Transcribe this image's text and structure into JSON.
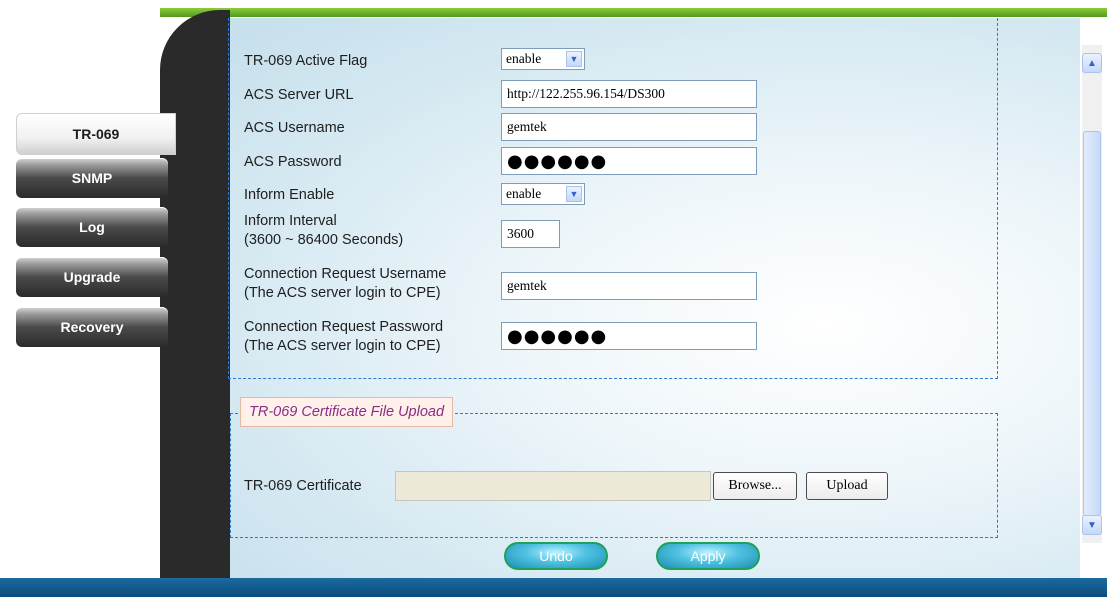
{
  "sidebar": {
    "items": [
      {
        "label": "TR-069",
        "active": true
      },
      {
        "label": "SNMP",
        "active": false
      },
      {
        "label": "Log",
        "active": false
      },
      {
        "label": "Upgrade",
        "active": false
      },
      {
        "label": "Recovery",
        "active": false
      }
    ]
  },
  "form": {
    "active_flag": {
      "label": "TR-069 Active Flag",
      "value": "enable"
    },
    "acs_url": {
      "label": "ACS Server URL",
      "value": "http://122.255.96.154/DS300"
    },
    "acs_username": {
      "label": "ACS Username",
      "value": "gemtek"
    },
    "acs_password": {
      "label": "ACS Password",
      "value": "●●●●●●"
    },
    "inform_enable": {
      "label": "Inform Enable",
      "value": "enable"
    },
    "inform_interval": {
      "label_line1": "Inform Interval",
      "label_line2": "(3600 ~ 86400 Seconds)",
      "value": "3600"
    },
    "conn_req_username": {
      "label_line1": "Connection Request Username",
      "label_line2": "(The ACS server login to CPE)",
      "value": "gemtek"
    },
    "conn_req_password": {
      "label_line1": "Connection Request Password",
      "label_line2": "(The ACS server login to CPE)",
      "value": "●●●●●●"
    }
  },
  "certificate": {
    "legend": "TR-069 Certificate File Upload",
    "label": "TR-069 Certificate",
    "file_value": "",
    "browse_label": "Browse...",
    "upload_label": "Upload"
  },
  "actions": {
    "undo_label": "Undo",
    "apply_label": "Apply"
  },
  "icons": {
    "select_arrow": "chevron-down-icon",
    "scroll_up": "chevron-up-icon",
    "scroll_down": "chevron-down-icon"
  },
  "colors": {
    "top_accent": "#6bb52a",
    "bottom_bar": "#0b4d7c",
    "dashed_border": "#2c7bd1",
    "legend_text": "#8b2c86",
    "frame_dark": "#2a2a2a"
  }
}
